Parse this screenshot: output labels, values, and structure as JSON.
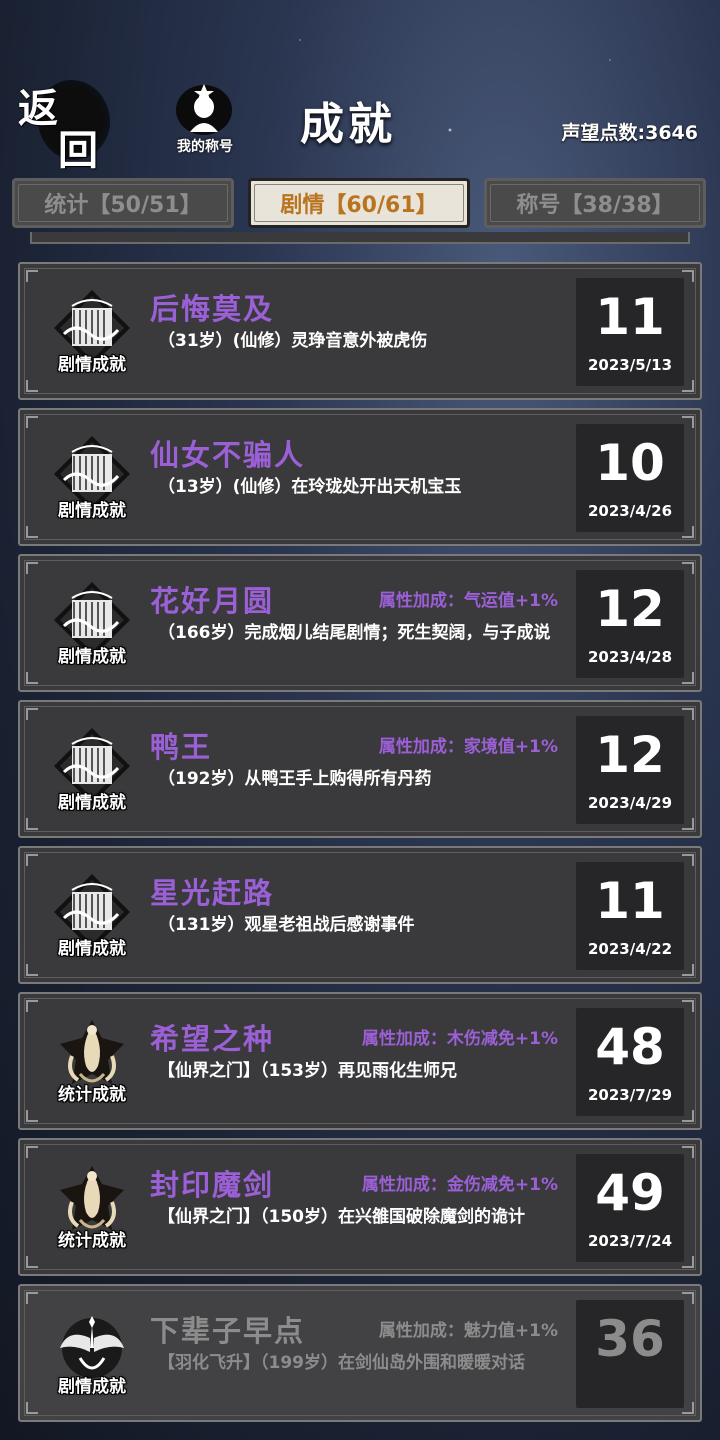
{
  "header": {
    "back_label_1": "返",
    "back_label_2": "回",
    "my_title_label": "我的称号",
    "page_title": "成就",
    "prestige": "声望点数:3646"
  },
  "tabs": [
    {
      "label": "统计【50/51】",
      "active": false
    },
    {
      "label": "剧情【60/61】",
      "active": true
    },
    {
      "label": "称号【38/38】",
      "active": false
    }
  ],
  "colors": {
    "accent_purple": "#9b5fd6",
    "active_tab_text": "#b8741f",
    "locked_text": "#8c8c8c"
  },
  "achievements": [
    {
      "badge_type": "story",
      "badge_icon": "story-achievement-icon",
      "badge_label": "剧情成就",
      "name": "后悔莫及",
      "bonus": "",
      "desc": "（31岁）(仙修）灵琤音意外被虎伤",
      "score": "11",
      "date": "2023/5/13",
      "locked": false
    },
    {
      "badge_type": "story",
      "badge_icon": "story-achievement-icon",
      "badge_label": "剧情成就",
      "name": "仙女不骗人",
      "bonus": "",
      "desc": "（13岁）(仙修）在玲珑处开出天机宝玉",
      "score": "10",
      "date": "2023/4/26",
      "locked": false
    },
    {
      "badge_type": "story",
      "badge_icon": "story-achievement-icon",
      "badge_label": "剧情成就",
      "name": "花好月圆",
      "bonus": "属性加成：气运值+1%",
      "desc": "（166岁）完成烟儿结尾剧情；死生契阔，与子成说",
      "score": "12",
      "date": "2023/4/28",
      "locked": false
    },
    {
      "badge_type": "story",
      "badge_icon": "story-achievement-icon",
      "badge_label": "剧情成就",
      "name": "鸭王",
      "bonus": "属性加成：家境值+1%",
      "desc": "（192岁）从鸭王手上购得所有丹药",
      "score": "12",
      "date": "2023/4/29",
      "locked": false
    },
    {
      "badge_type": "story",
      "badge_icon": "story-achievement-icon",
      "badge_label": "剧情成就",
      "name": "星光赶路",
      "bonus": "",
      "desc": "（131岁）观星老祖战后感谢事件",
      "score": "11",
      "date": "2023/4/22",
      "locked": false
    },
    {
      "badge_type": "stat",
      "badge_icon": "stat-achievement-icon",
      "badge_label": "统计成就",
      "name": "希望之种",
      "bonus": "属性加成：木伤减免+1%",
      "desc": "【仙界之门】（153岁）再见雨化生师兄",
      "score": "48",
      "date": "2023/7/29",
      "locked": false
    },
    {
      "badge_type": "stat",
      "badge_icon": "stat-achievement-icon",
      "badge_label": "统计成就",
      "name": "封印魔剑",
      "bonus": "属性加成：金伤减免+1%",
      "desc": "【仙界之门】（150岁）在兴雒国破除魔剑的诡计",
      "score": "49",
      "date": "2023/7/24",
      "locked": false
    },
    {
      "badge_type": "wing",
      "badge_icon": "winged-achievement-icon",
      "badge_label": "剧情成就",
      "name": "下辈子早点",
      "bonus": "属性加成：魅力值+1%",
      "desc": "【羽化飞升】（199岁）在剑仙岛外围和暖暖对话",
      "score": "36",
      "date": "",
      "locked": true
    }
  ]
}
